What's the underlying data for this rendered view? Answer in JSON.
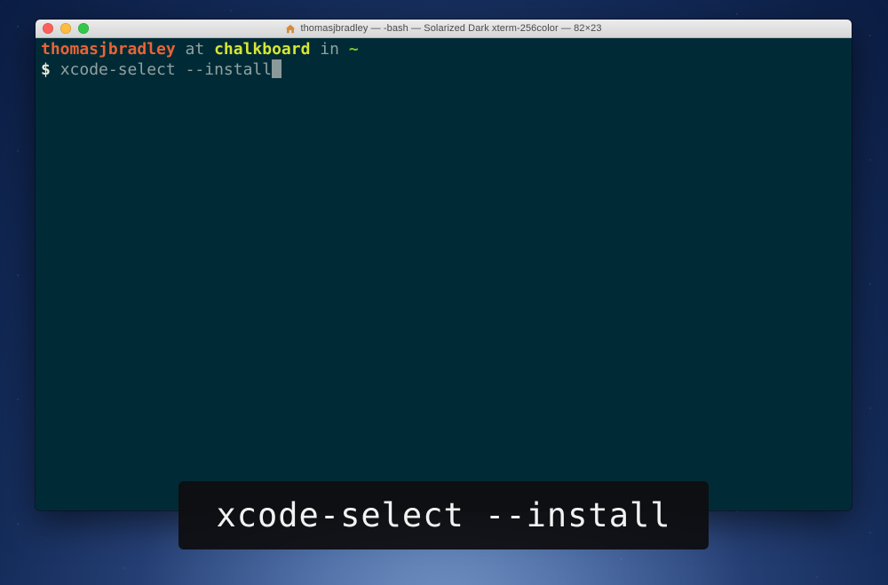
{
  "window": {
    "title": "thomasjbradley — -bash — Solarized Dark xterm-256color — 82×23",
    "title_icon": "home-icon"
  },
  "terminal": {
    "prompt": {
      "user": "thomasjbradley",
      "at_text": " at ",
      "host": "chalkboard",
      "in_text": " in ",
      "cwd": "~"
    },
    "command_line": {
      "symbol": "$",
      "command": "xcode-select --install"
    }
  },
  "caption": {
    "text": "xcode-select --install"
  },
  "colors": {
    "terminal_bg": "#002b36",
    "user": "#e86436",
    "host": "#d7e634",
    "cwd": "#7cc629",
    "text": "#93a1a1"
  }
}
